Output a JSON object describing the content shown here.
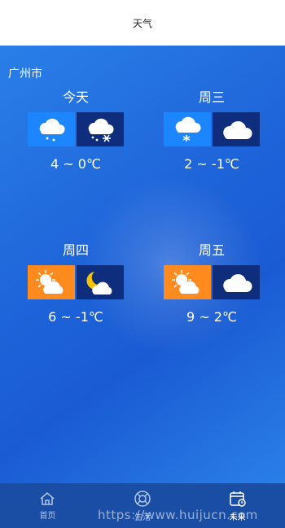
{
  "header": {
    "title": "天气"
  },
  "location": {
    "city": "广州市"
  },
  "forecast": [
    {
      "day": "今天",
      "temp": "4 ~ 0℃"
    },
    {
      "day": "周三",
      "temp": "2 ~ -1℃"
    },
    {
      "day": "周四",
      "temp": "6 ~ -1℃"
    },
    {
      "day": "周五",
      "temp": "9 ~ 2℃"
    }
  ],
  "tabs": [
    {
      "label": "首页"
    },
    {
      "label": "生活"
    },
    {
      "label": "未来"
    }
  ],
  "watermark": "https://www.huijucn.com"
}
